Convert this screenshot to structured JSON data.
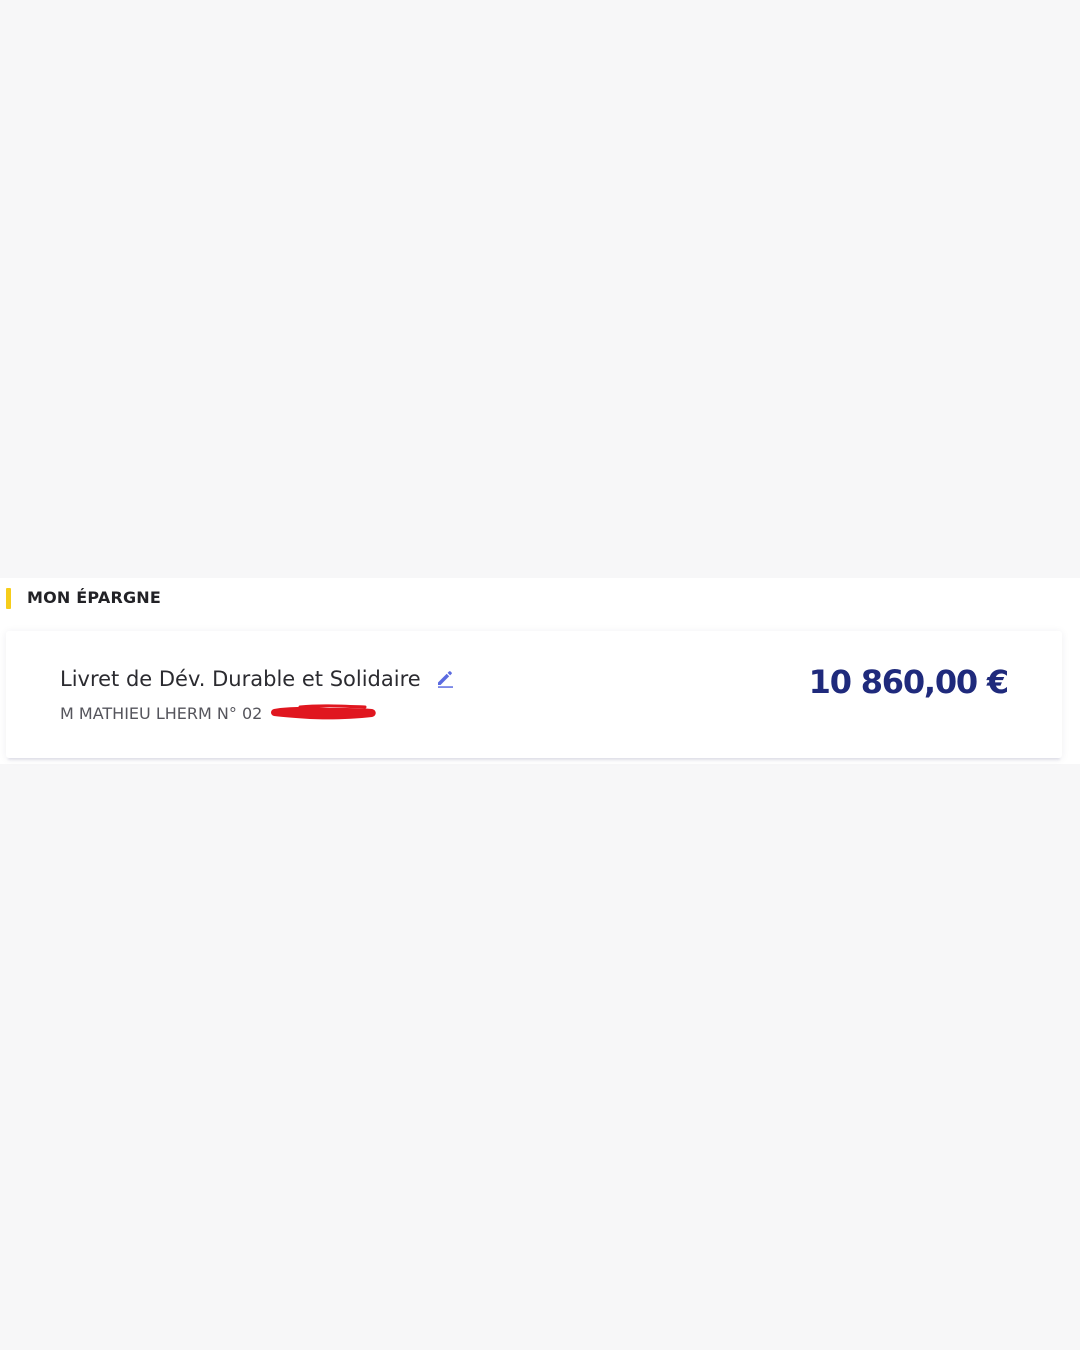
{
  "section": {
    "title": "MON ÉPARGNE",
    "accent_color": "#f6cd1a"
  },
  "account": {
    "name": "Livret de Dév. Durable et Solidaire",
    "holder_line": "M MATHIEU LHERM N° 02",
    "balance": "10 860,00 €",
    "balance_color": "#1f2a7c",
    "edit_icon": "pencil-icon",
    "redaction_color": "#e0161f"
  }
}
